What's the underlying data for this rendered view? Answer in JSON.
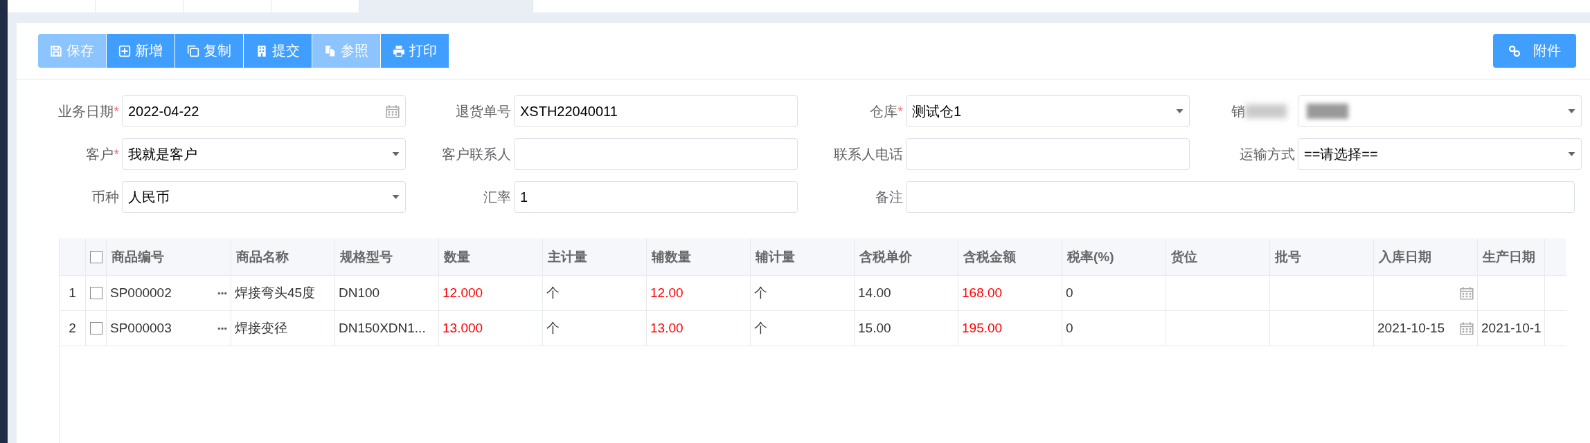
{
  "tabs": [
    {
      "selected": false
    },
    {
      "selected": false
    },
    {
      "selected": false
    },
    {
      "selected": false
    },
    {
      "selected": true
    }
  ],
  "toolbar": {
    "buttons": [
      {
        "kind": "save",
        "label": "保存",
        "disabled": true
      },
      {
        "kind": "add",
        "label": "新增",
        "disabled": false
      },
      {
        "kind": "copy",
        "label": "复制",
        "disabled": false
      },
      {
        "kind": "submit",
        "label": "提交",
        "disabled": false
      },
      {
        "kind": "reference",
        "label": "参照",
        "disabled": true
      },
      {
        "kind": "print",
        "label": "打印",
        "disabled": false
      }
    ],
    "attach_button": {
      "label": "附件"
    }
  },
  "form": {
    "fields": [
      {
        "label": "业务日期",
        "required_mark": "*",
        "kind": "date",
        "value": "2022-04-22"
      },
      {
        "label": "退货单号",
        "kind": "text",
        "value": "XSTH22040011"
      },
      {
        "label": "仓库",
        "required_mark": "*",
        "kind": "select",
        "value": "测试仓1"
      },
      {
        "label": "销",
        "kind": "select",
        "blurred": true
      },
      {
        "label": "客户",
        "required_mark": "*",
        "kind": "select",
        "value": "我就是客户"
      },
      {
        "label": "客户联系人",
        "kind": "text"
      },
      {
        "label": "联系人电话",
        "kind": "text"
      },
      {
        "label": "运输方式",
        "kind": "select",
        "placeholder": "==请选择=="
      },
      {
        "label": "币种",
        "kind": "select",
        "value": "人民币"
      },
      {
        "label": "汇率",
        "kind": "text",
        "value": "1"
      },
      {
        "label": "备注",
        "kind": "wide_text"
      }
    ]
  },
  "table": {
    "header_checkbox": {
      "checked": false
    },
    "columns": [
      {
        "label": "商品编号",
        "kind": "lookup"
      },
      {
        "label": "商品名称",
        "kind": "text"
      },
      {
        "label": "规格型号",
        "kind": "text"
      },
      {
        "label": "数量",
        "kind": "text",
        "color": "#ff0000"
      },
      {
        "label": "主计量",
        "kind": "text"
      },
      {
        "label": "辅数量",
        "kind": "text",
        "color": "#ff0000"
      },
      {
        "label": "辅计量",
        "kind": "text"
      },
      {
        "label": "含税单价",
        "kind": "text"
      },
      {
        "label": "含税金额",
        "kind": "text",
        "color": "#ff0000"
      },
      {
        "label": "税率(%)",
        "kind": "text"
      },
      {
        "label": "货位",
        "kind": "text"
      },
      {
        "label": "批号",
        "kind": "text"
      },
      {
        "label": "入库日期",
        "kind": "date"
      },
      {
        "label": "生产日期",
        "kind": "text"
      }
    ],
    "rows": [
      {
        "index": "1",
        "checked": false,
        "cells": [
          "SP000002",
          "焊接弯头45度",
          "DN100",
          "12.000",
          "个",
          "12.00",
          "个",
          "14.00",
          "168.00",
          "0",
          "",
          "",
          "",
          ""
        ]
      },
      {
        "index": "2",
        "checked": false,
        "cells": [
          "SP000003",
          "焊接变径",
          "DN150XDN1...",
          "13.000",
          "个",
          "13.00",
          "个",
          "15.00",
          "195.00",
          "0",
          "",
          "",
          "2021-10-15",
          "2021-10-1"
        ]
      }
    ]
  }
}
